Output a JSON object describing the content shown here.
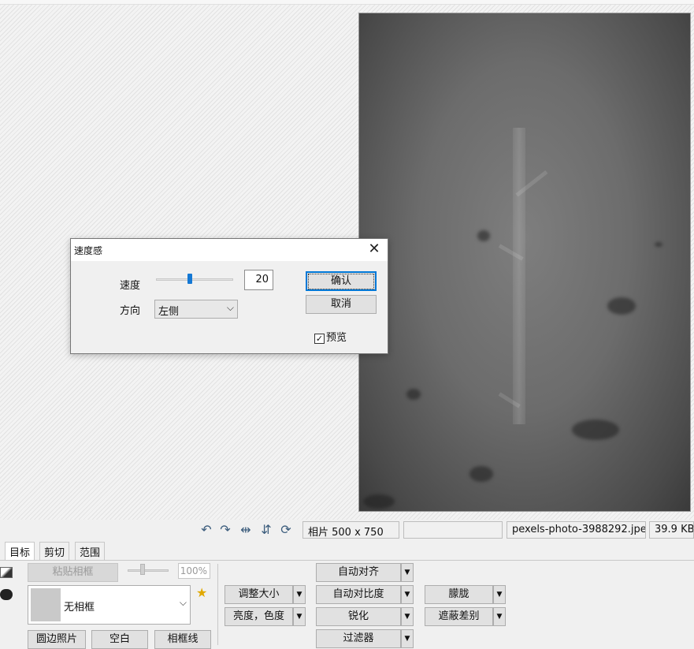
{
  "dialog": {
    "title": "速度感",
    "close_glyph": "✕",
    "speed_label": "速度",
    "speed_value": "20",
    "speed_slider_fraction": 0.44,
    "direction_label": "方向",
    "direction_selected": "左侧",
    "ok_label": "确认",
    "cancel_label": "取消",
    "preview_label": "预览",
    "preview_checked": true
  },
  "statusbar": {
    "icons": [
      "rotate-left-icon",
      "rotate-right-icon",
      "flip-horizontal-icon",
      "flip-vertical-icon",
      "refresh-icon"
    ],
    "dimensions": "相片 500 x 750",
    "blank": "",
    "filename": "pexels-photo-3988292.jpeg",
    "filesize": "39.9 KB"
  },
  "tabs": [
    "目标",
    "剪切",
    "范围"
  ],
  "panel": {
    "paste_frame": "粘贴相框",
    "opacity": "100%",
    "frame_selected": "无相框",
    "frame_border_photo": "圆边照片",
    "blank_btn": "空白",
    "frame_line": "相框线",
    "resize": "调整大小",
    "brightness": "亮度，色度",
    "auto_align": "自动对齐",
    "auto_contrast": "自动对比度",
    "sharpen": "锐化",
    "filter": "过滤器",
    "blur": "朦胧",
    "mask_diff": "遮蔽差别"
  }
}
